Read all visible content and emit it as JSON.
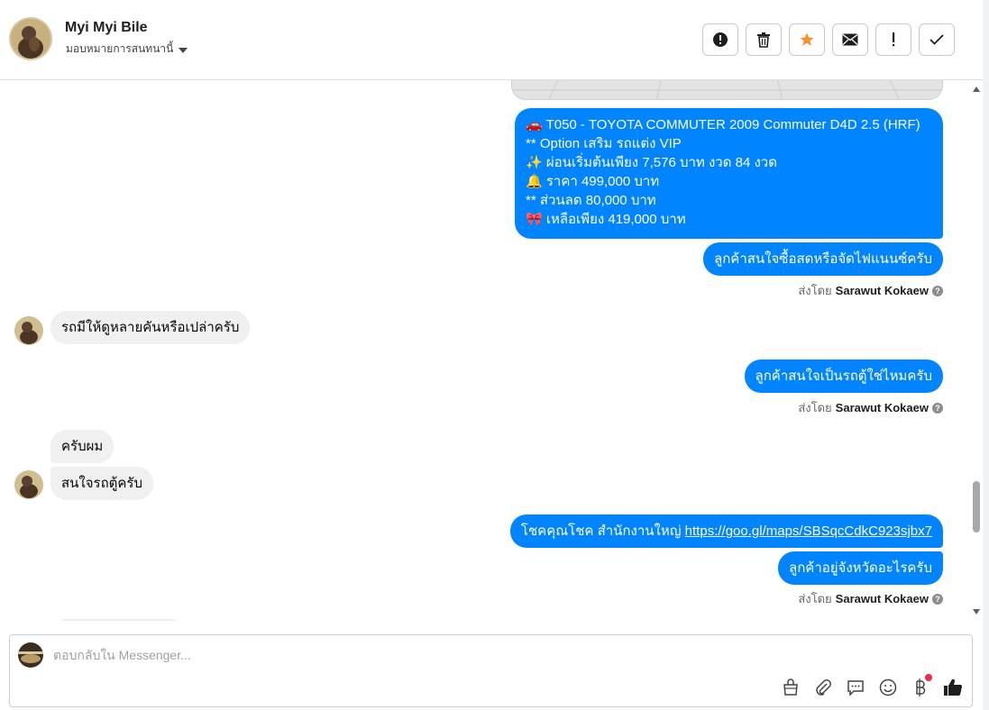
{
  "header": {
    "contact_name": "Myi Myi Bile",
    "assign_label": "มอบหมายการสนทนานี้"
  },
  "actions": [
    {
      "name": "spam-button",
      "icon": "alert-circle-icon"
    },
    {
      "name": "delete-button",
      "icon": "trash-icon"
    },
    {
      "name": "star-button",
      "icon": "star-icon"
    },
    {
      "name": "mark-unread-button",
      "icon": "envelope-icon"
    },
    {
      "name": "follow-up-button",
      "icon": "exclamation-icon"
    },
    {
      "name": "mark-done-button",
      "icon": "checkmark-icon"
    }
  ],
  "messages": {
    "product_lines": [
      "🚗 T050 - TOYOTA COMMUTER  2009 Commuter D4D 2.5 (HRF)",
      "** Option เสริม รถแต่ง VIP",
      "✨ ผ่อนเริ่มต้นเพียง 7,576 บาท งวด 84 งวด",
      "🔔 ราคา 499,000 บาท",
      "** ส่วนลด 80,000 บาท",
      "🎀 เหลือเพียง 419,000 บาท"
    ],
    "out_1": "ลูกค้าสนใจซื้อสดหรือจัดไฟแนนซ์ครับ",
    "in_1": "รถมีให้ดูหลายคันหรือเปล่าครับ",
    "out_2": "ลูกค้าสนใจเป็นรถตู้ใช่ไหมครับ",
    "in_2": "ครับผม",
    "in_3": "สนใจรถตู้ครับ",
    "out_3_prefix": "โชคคุณโชค สำนักงานใหญ่ ",
    "out_3_link": "https://goo.gl/maps/SBSqcCdkC923sjbx7",
    "out_4": "ลูกค้าอยู่จังหวัดอะไรครับ",
    "sent_by_label": "ส่งโดย",
    "sent_by_name": "Sarawut Kokaew"
  },
  "composer": {
    "placeholder": "ตอบกลับใน Messenger...",
    "tools": [
      "shopping-bag-icon",
      "paperclip-icon",
      "saved-replies-icon",
      "emoji-icon",
      "baht-payment-icon",
      "thumbs-up-icon"
    ]
  },
  "colors": {
    "outgoing_bubble": "#0084ff",
    "incoming_bubble": "#f0f0f0",
    "star_accent": "#f5922b",
    "notification_dot": "#f0284a"
  }
}
